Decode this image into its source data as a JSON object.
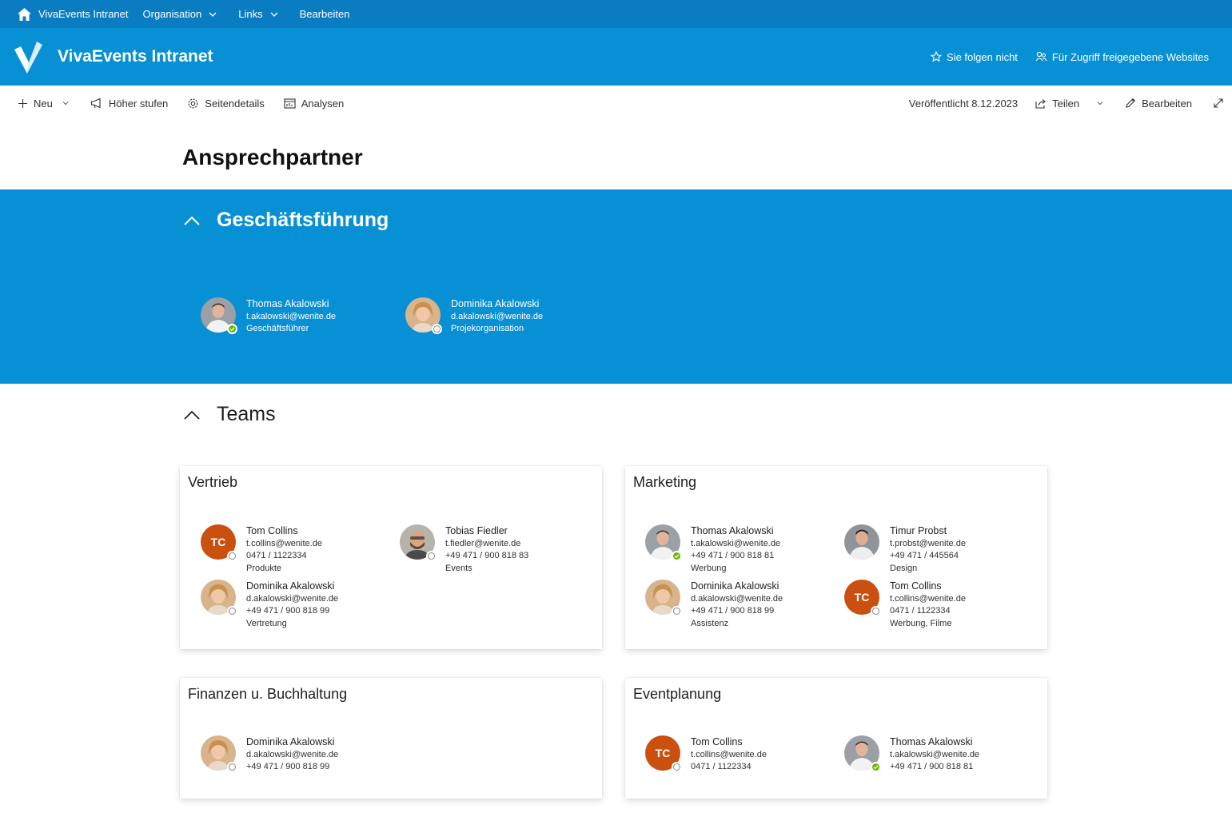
{
  "suitebar": {
    "site_name": "VivaEvents Intranet",
    "nav": [
      {
        "label": "Organisation"
      },
      {
        "label": "Links"
      },
      {
        "label": "Bearbeiten"
      }
    ]
  },
  "header": {
    "title": "VivaEvents Intranet",
    "follow": "Sie folgen nicht",
    "shared": "Für Zugriff freigegebene Websites"
  },
  "commandbar": {
    "new": "Neu",
    "promote": "Höher stufen",
    "details": "Seitendetails",
    "analytics": "Analysen",
    "published": "Veröffentlicht 8.12.2023",
    "share": "Teilen",
    "edit": "Bearbeiten"
  },
  "page": {
    "title": "Ansprechpartner"
  },
  "management": {
    "title": "Geschäftsführung",
    "people": [
      {
        "name": "Thomas Akalowski",
        "email": "t.akalowski@wenite.de",
        "role": "Geschäftsführer",
        "presence": "available"
      },
      {
        "name": "Dominika Akalowski",
        "email": "d.akalowski@wenite.de",
        "role": "Projekorganisation",
        "presence": "offline"
      }
    ]
  },
  "teams": {
    "title": "Teams",
    "cards": [
      {
        "title": "Vertrieb",
        "people": [
          {
            "name": "Tom Collins",
            "email": "t.collins@wenite.de",
            "phone": "0471 / 1122334",
            "role": "Produkte",
            "initials": "TC",
            "presence": "offline"
          },
          {
            "name": "Tobias Fiedler",
            "email": "t.fiedler@wenite.de",
            "phone": "+49 471 / 900 818 83",
            "role": "Events",
            "presence": "offline"
          },
          {
            "name": "Dominika Akalowski",
            "email": "d.akalowski@wenite.de",
            "phone": "+49 471 / 900 818 99",
            "role": "Vertretung",
            "presence": "offline"
          }
        ]
      },
      {
        "title": "Marketing",
        "people": [
          {
            "name": "Thomas Akalowski",
            "email": "t.akalowski@wenite.de",
            "phone": "+49 471 / 900 818 81",
            "role": "Werbung",
            "presence": "available"
          },
          {
            "name": "Timur Probst",
            "email": "t.probst@wenite.de",
            "phone": "+49 471 / 445564",
            "role": "Design",
            "presence": "none"
          },
          {
            "name": "Dominika Akalowski",
            "email": "d.akalowski@wenite.de",
            "phone": "+49 471 / 900 818 99",
            "role": "Assistenz",
            "presence": "offline"
          },
          {
            "name": "Tom Collins",
            "email": "t.collins@wenite.de",
            "phone": "0471 / 1122334",
            "role": "Werbung, Filme",
            "initials": "TC",
            "presence": "offline"
          }
        ]
      },
      {
        "title": "Finanzen u. Buchhaltung",
        "people": [
          {
            "name": "Dominika Akalowski",
            "email": "d.akalowski@wenite.de",
            "phone": "+49 471 / 900 818 99",
            "presence": "offline"
          }
        ]
      },
      {
        "title": "Eventplanung",
        "people": [
          {
            "name": "Tom Collins",
            "email": "t.collins@wenite.de",
            "phone": "0471 / 1122334",
            "initials": "TC",
            "presence": "offline"
          },
          {
            "name": "Thomas Akalowski",
            "email": "t.akalowski@wenite.de",
            "phone": "+49 471 / 900 818 81",
            "presence": "available"
          }
        ]
      }
    ]
  }
}
